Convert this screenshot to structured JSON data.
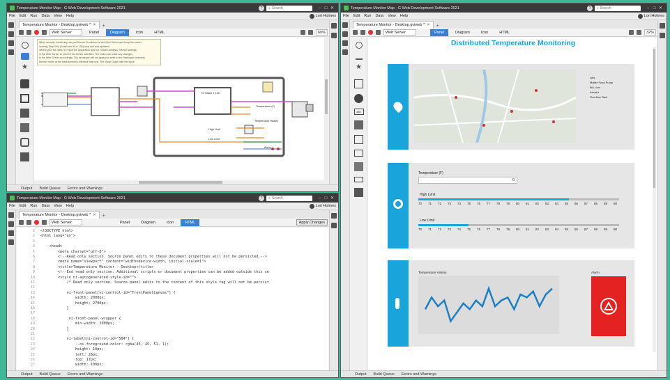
{
  "colors": {
    "accent": "#1aa4dc",
    "alarm": "#e52222",
    "background": "#3fb897"
  },
  "window_title": "Temperature Monitor Map - G Web Development Software 2021",
  "menu": [
    "File",
    "Edit",
    "Run",
    "Data",
    "View",
    "Help"
  ],
  "user": "Lori Holmes",
  "search_placeholder": "Search",
  "doc_tab": "Temperature Monitor - Desktop.gviweb *",
  "target_select": "Web Server",
  "view_tabs": [
    "Panel",
    "Diagram",
    "Icon",
    "HTML"
  ],
  "zoom": "60%",
  "zoom_right": "32%",
  "apply_changes": "Apply Changes",
  "status_tabs": [
    "Output",
    "Build Queue",
    "Errors and Warnings"
  ],
  "diagram": {
    "comment": [
      "When security monitoring, we poll Sensor Prediction for the Web Server and keep the server",
      "running. Map Grid (Graph are 50 is 100) loop and rest aprintted.",
      "Where your the mark, to report the application and run Secure Analysis, Sensor settings",
      "in the Web Server to prevent the sensor activities. The vision will relate any changes",
      "to the Web Server accordingly. The developer will not appear to write to the Hardware Inventory",
      "Monitor mode at the back-selection interface this runs. The Tomp Graph with the Input."
    ],
    "loop_label": "N: Wake 1 100",
    "node_labels": [
      "Temperature (F)",
      "High Limit",
      "Low Limit",
      "Alarm",
      "Temperature History"
    ]
  },
  "code_lines": [
    "<!DOCTYPE html>",
    "<html lang=\"en\">",
    "",
    "    <head>",
    "        <meta charset=\"utf-8\">",
    "        <!--Read only section. Source panel edits to these document properties will not be persisted.-->",
    "        <meta name=\"viewport\" content=\"width=device-width, initial-scale=1\">",
    "        <title>Temperature Monitor - Desktop</title>",
    "        <!--End read only section. Additional scripts or document properties can be added outside this se",
    "        <style ni-autogenerated-style-id=\"\">",
    "            /* Read only section. Source panel edits to the content of this style tag will not be persist",
    "",
    "            ni-front-panel[ni-control-id=\"FrontPanelCanvas\"] {",
    "                width: 2000px;",
    "                height: 2700px;",
    "            }",
    "",
    "            .ni-front-panel-wrapper {",
    "                min-width: 2000px;",
    "            }",
    "",
    "            ni-label[ni-control-id=\"584\"] {",
    "                --ni-foreground-color: rgba(45, 45, 51, 1);",
    "                height: 10px;",
    "                left: 26px;",
    "                top: 17px;",
    "                width: 100px;"
  ],
  "panel": {
    "heading": "Distributed Temperature Monitoring",
    "map_legend": [
      "Libs",
      "Matter Food Pump",
      "Bio-Line",
      "Aerator",
      "Overflow Tank"
    ],
    "temperature_label": "Temperature (F)",
    "temperature_value": "0",
    "high_limit_label": "High Limit",
    "low_limit_label": "Low Limit",
    "high_limit": 85,
    "low_limit": 75,
    "scale_ticks": [
      "70",
      "71",
      "72",
      "73",
      "74",
      "75",
      "76",
      "77",
      "78",
      "79",
      "80",
      "81",
      "82",
      "83",
      "84",
      "85",
      "86",
      "87",
      "88",
      "89",
      "90"
    ],
    "history_label": "Temperature History",
    "alarm_label": "Alarm",
    "history_values": [
      70,
      74,
      71,
      73,
      66,
      69,
      72,
      70,
      73,
      71,
      77,
      71,
      73,
      74,
      70,
      75,
      74,
      76,
      71,
      75,
      77
    ]
  }
}
